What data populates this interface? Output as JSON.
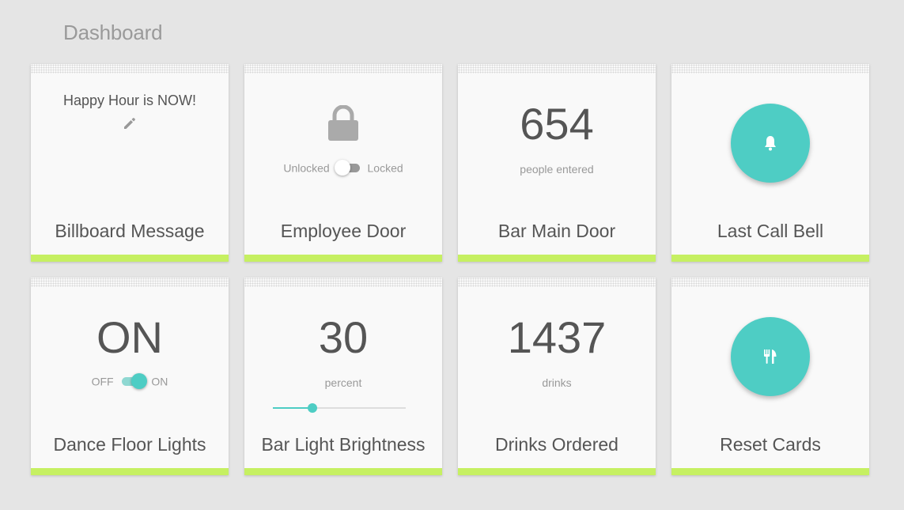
{
  "page": {
    "title": "Dashboard"
  },
  "colors": {
    "accent": "#4ecdc4",
    "card_bar": "#c6f062",
    "background": "#e5e5e5"
  },
  "cards": [
    {
      "label": "Billboard Message",
      "message": "Happy Hour is NOW!",
      "icon": "pencil-icon"
    },
    {
      "label": "Employee Door",
      "icon": "lock-icon",
      "toggle": {
        "off_label": "Unlocked",
        "on_label": "Locked",
        "state": "off"
      }
    },
    {
      "label": "Bar Main Door",
      "value": "654",
      "unit": "people entered"
    },
    {
      "label": "Last Call Bell",
      "icon": "bell-icon"
    },
    {
      "label": "Dance Floor Lights",
      "value": "ON",
      "toggle": {
        "off_label": "OFF",
        "on_label": "ON",
        "state": "on"
      }
    },
    {
      "label": "Bar Light Brightness",
      "value": "30",
      "unit": "percent",
      "slider_percent": 30
    },
    {
      "label": "Drinks Ordered",
      "value": "1437",
      "unit": "drinks"
    },
    {
      "label": "Reset Cards",
      "icon": "utensils-icon"
    }
  ]
}
